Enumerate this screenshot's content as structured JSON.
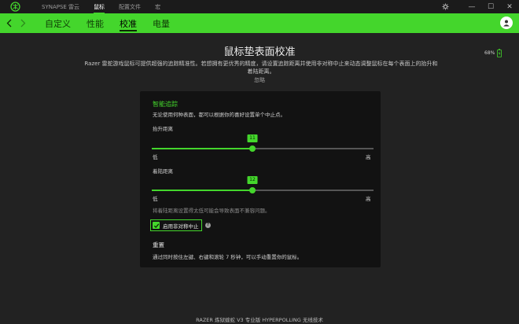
{
  "titlebar": {
    "tabs": [
      {
        "label": "SYNAPSE 雷云"
      },
      {
        "label": "鼠标"
      },
      {
        "label": "配置文件"
      },
      {
        "label": "宏"
      }
    ],
    "active_tab": "鼠标",
    "controls": {
      "settings_icon": "gear-icon",
      "minimize": "—",
      "maximize": "☐",
      "close": "✕"
    }
  },
  "navbar": {
    "tabs": [
      {
        "label": "自定义"
      },
      {
        "label": "性能"
      },
      {
        "label": "校准"
      },
      {
        "label": "电量"
      }
    ],
    "active_tab": "校准",
    "accent_color": "#44d62c"
  },
  "page": {
    "title": "鼠标垫表面校准",
    "description": "Razer 雷蛇游戏鼠标可提供超强的追踪精准性。若想拥有更优秀的精度，请设置追踪距离并使用非对称中止来动态调整鼠标在每个表面上的抬升和着陆距离。",
    "ignore_link": "忽略",
    "battery": "68%"
  },
  "panel": {
    "section_title": "智能追踪",
    "section_desc": "无论使用何种表面，都可以根据你的喜好设置单个中止点。",
    "lift_label": "抬升距离",
    "lift_value": "11",
    "lift_fraction": 0.455,
    "land_label": "着陆距离",
    "land_value": "12",
    "land_fraction": 0.455,
    "low_label": "低",
    "high_label": "高",
    "note": "将着陆距离设置得太低可能会导致表面不兼容问题。",
    "asym_label": "启用非对称中止",
    "asym_checked": true,
    "reset_title": "重置",
    "reset_desc": "通过同时按住左键、右键和滚轮 7 秒钟，可以手动重置你的鼠标。"
  },
  "footer": {
    "device_name": "RAZER 炼狱蝰蛇 V3 专业版 HYPERPOLLING 无线技术"
  }
}
